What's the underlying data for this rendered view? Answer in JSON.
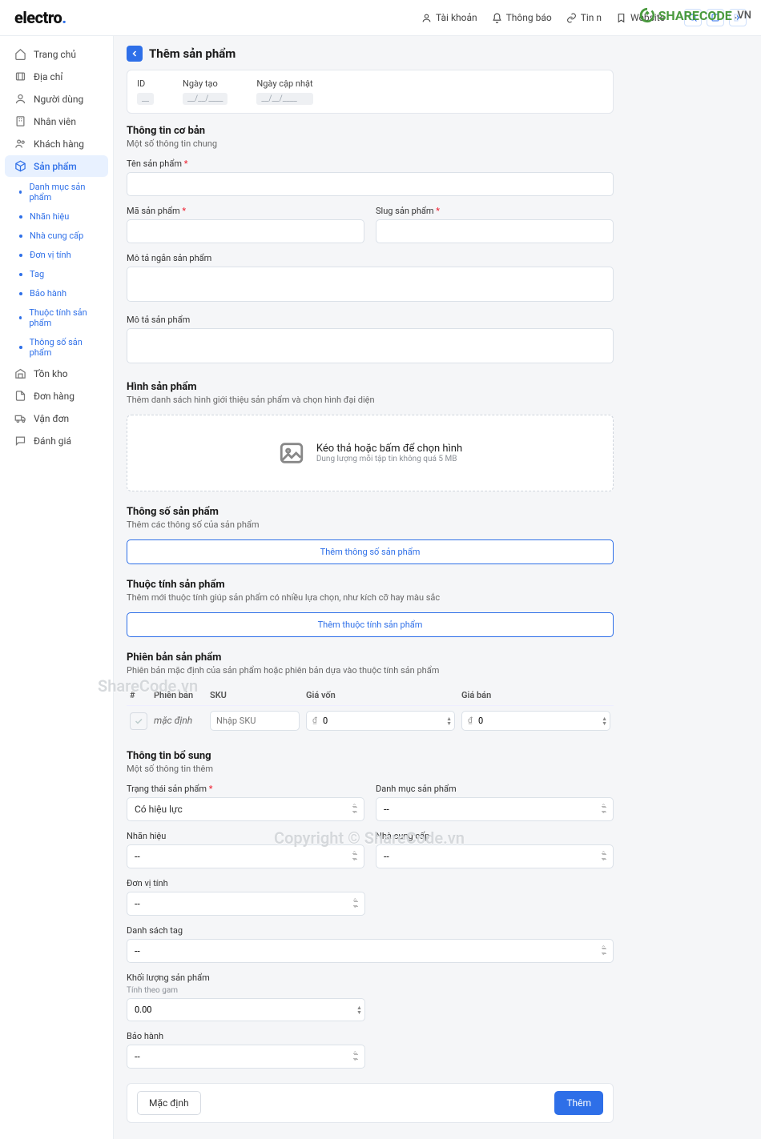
{
  "brand": {
    "name": "electro",
    "dot": "."
  },
  "header": {
    "account": "Tài khoản",
    "notifications": "Thông báo",
    "news": "Tin n",
    "website": "Website"
  },
  "sidebar": {
    "home": "Trang chủ",
    "address": "Địa chỉ",
    "users": "Người dùng",
    "staff": "Nhân viên",
    "customers": "Khách hàng",
    "products": "Sản phẩm",
    "sub": {
      "category": "Danh mục sản phẩm",
      "brand": "Nhãn hiệu",
      "supplier": "Nhà cung cấp",
      "unit": "Đơn vị tính",
      "tag": "Tag",
      "warranty": "Bảo hành",
      "attributes": "Thuộc tính sản phẩm",
      "specs": "Thông số sản phẩm"
    },
    "inventory": "Tồn kho",
    "orders": "Đơn hàng",
    "waybill": "Vận đơn",
    "reviews": "Đánh giá"
  },
  "page": {
    "title": "Thêm sản phẩm"
  },
  "meta": {
    "id_label": "ID",
    "created_label": "Ngày tạo",
    "updated_label": "Ngày cập nhật",
    "id_val": "__",
    "created_val": "__/__/____",
    "updated_val": "__/__/____"
  },
  "basic": {
    "title": "Thông tin cơ bản",
    "desc": "Một số thông tin chung",
    "name_label": "Tên sản phẩm",
    "code_label": "Mã sản phẩm",
    "slug_label": "Slug sản phẩm",
    "short_desc_label": "Mô tả ngắn sản phẩm",
    "desc_label": "Mô tả sản phẩm"
  },
  "images": {
    "title": "Hình sản phẩm",
    "desc": "Thêm danh sách hình giới thiệu sản phẩm và chọn hình đại diện",
    "dz_main": "Kéo thả hoặc bấm để chọn hình",
    "dz_sub": "Dung lượng mỗi tập tin không quá 5 MB"
  },
  "specs": {
    "title": "Thông số sản phẩm",
    "desc": "Thêm các thông số của sản phẩm",
    "btn": "Thêm thông số sản phẩm"
  },
  "attrs": {
    "title": "Thuộc tính sản phẩm",
    "desc": "Thêm mới thuộc tính giúp sản phẩm có nhiều lựa chọn, như kích cỡ hay màu sắc",
    "btn": "Thêm thuộc tính sản phẩm"
  },
  "variants": {
    "title": "Phiên bản sản phẩm",
    "desc": "Phiên bản mặc định của sản phẩm hoặc phiên bản dựa vào thuộc tính sản phẩm",
    "cols": {
      "idx": "#",
      "variant": "Phiên bản",
      "sku": "SKU",
      "cost": "Giá vốn",
      "price": "Giá bán"
    },
    "row": {
      "name": "mặc định",
      "sku_ph": "Nhập SKU",
      "cost": "0",
      "price": "0",
      "currency": "₫"
    }
  },
  "extra": {
    "title": "Thông tin bổ sung",
    "desc": "Một số thông tin thêm",
    "status_label": "Trạng thái sản phẩm",
    "status_value": "Có hiệu lực",
    "category_label": "Danh mục sản phẩm",
    "brand_label": "Nhãn hiệu",
    "supplier_label": "Nhà cung cấp",
    "unit_label": "Đơn vị tính",
    "tags_label": "Danh sách tag",
    "weight_label": "Khối lượng sản phẩm",
    "weight_sub": "Tính theo gam",
    "weight_value": "0.00",
    "warranty_label": "Bảo hành",
    "placeholder": "--"
  },
  "footer": {
    "default": "Mặc định",
    "add": "Thêm"
  },
  "watermark": {
    "corner_main": "SHARECODE",
    "corner_suffix": ".VN",
    "left": "ShareCode.vn",
    "bottom": "Copyright © ShareCode.vn"
  }
}
